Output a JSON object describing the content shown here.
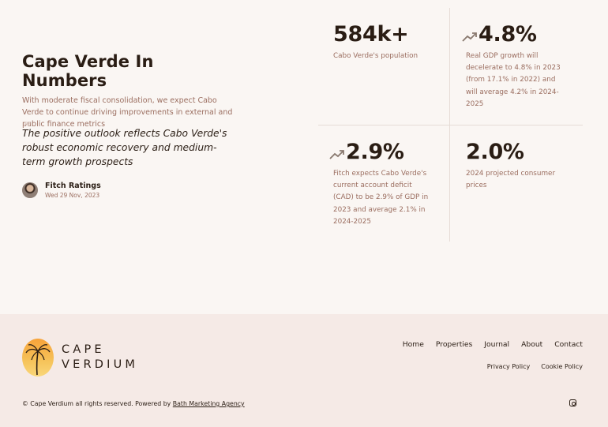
{
  "section": {
    "title": "Cape Verde In Numbers",
    "subtitle": "With moderate fiscal consolidation, we expect Cabo Verde to continue driving improvements in external and public finance metrics",
    "quote": "The positive outlook reflects Cabo Verde's robust economic recovery and medium-term growth prospects",
    "author": {
      "name": "Fitch Ratings",
      "date": "Wed 29 Nov, 2023"
    }
  },
  "stats": [
    {
      "value": "584k+",
      "description": "Cabo Verde's population",
      "icon": ""
    },
    {
      "value": "4.8%",
      "description": "Real GDP growth will decelerate to 4.8% in 2023 (from 17.1% in 2022) and will average 4.2% in 2024-2025",
      "icon": "trend-up-icon"
    },
    {
      "value": "2.9%",
      "description": "Fitch expects Cabo Verde's current account deficit (CAD) to be 2.9% of GDP in 2023 and average 2.1% in 2024-2025",
      "icon": "trend-up-icon"
    },
    {
      "value": "2.0%",
      "description": "2024 projected consumer prices",
      "icon": ""
    }
  ],
  "footer": {
    "logo_line1": "CAPE",
    "logo_line2": "VERDIUM",
    "nav": [
      "Home",
      "Properties",
      "Journal",
      "About",
      "Contact"
    ],
    "subnav": [
      "Privacy Policy",
      "Cookie Policy"
    ],
    "copyright_prefix": "© Cape Verdium all rights reserved. Powered by",
    "copyright_link": "Bath Marketing Agency",
    "social_icon": "instagram-icon"
  },
  "colors": {
    "accent": "#9b6e60",
    "dark": "#2a1d14",
    "footer_bg": "#f5eae6",
    "page_bg": "#faf6f3"
  }
}
